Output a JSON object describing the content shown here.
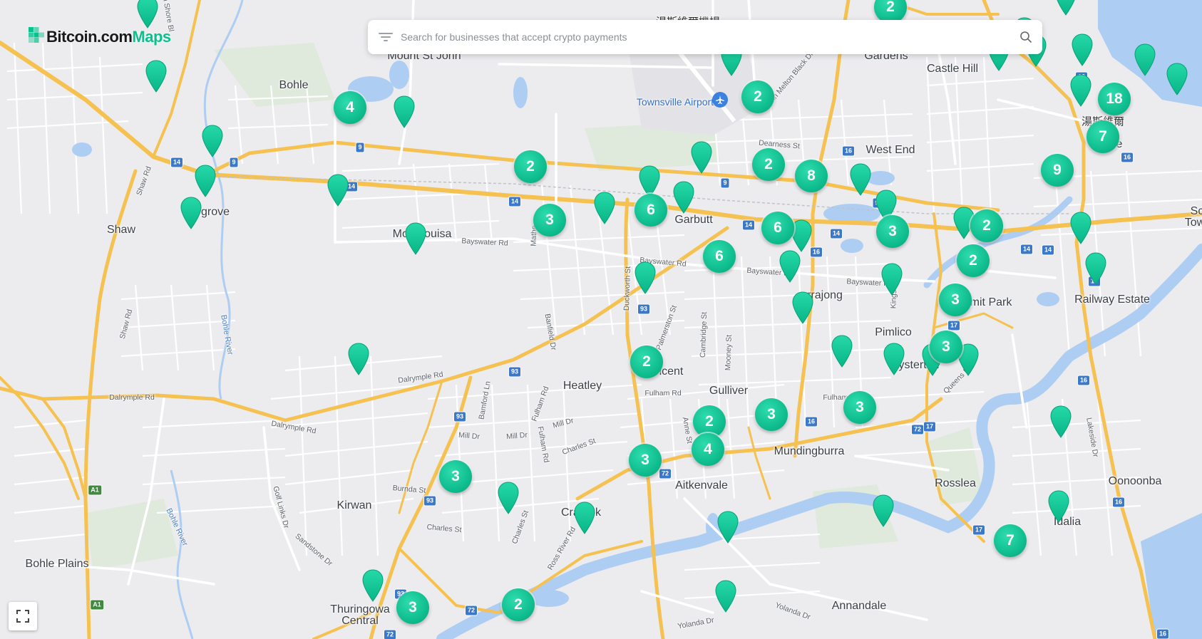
{
  "brand": {
    "name_primary": "Bitcoin.com",
    "name_secondary": "Maps",
    "accent_color": "#0ac18e"
  },
  "search": {
    "placeholder": "Search for businesses that accept crypto payments",
    "value": ""
  },
  "map": {
    "controls": {
      "fullscreen_icon": "fullscreen-icon"
    },
    "place_labels": [
      {
        "id": "mount-st-john",
        "text": "Mount St John",
        "kind": "suburb"
      },
      {
        "id": "bohle",
        "text": "Bohle",
        "kind": "suburb"
      },
      {
        "id": "gardens",
        "text": "Gardens",
        "kind": "suburb"
      },
      {
        "id": "castle-hill",
        "text": "Castle Hill",
        "kind": "suburb"
      },
      {
        "id": "townsville-airport",
        "text": "Townsville Airport",
        "kind": "airport"
      },
      {
        "id": "west-end",
        "text": "West End",
        "kind": "suburb"
      },
      {
        "id": "shaw",
        "text": "Shaw",
        "kind": "suburb"
      },
      {
        "id": "cosgrove",
        "text": "grove",
        "kind": "suburb"
      },
      {
        "id": "mount-louisa",
        "text": "Mou  Louisa",
        "kind": "suburb"
      },
      {
        "id": "garbutt",
        "text": "Garbutt",
        "kind": "suburb"
      },
      {
        "id": "currajong",
        "text": "rrajong",
        "kind": "suburb"
      },
      {
        "id": "pimlico",
        "text": "Pimlico",
        "kind": "suburb"
      },
      {
        "id": "hermit-park",
        "text": "mit Park",
        "kind": "suburb"
      },
      {
        "id": "railway-estate",
        "text": "Railway Estate",
        "kind": "suburb"
      },
      {
        "id": "townsville",
        "text": "To   ville",
        "kind": "suburb"
      },
      {
        "id": "townsville-cjk",
        "text": "湯斯維爾",
        "kind": "cjk"
      },
      {
        "id": "south-townsville-1",
        "text": "Sc",
        "kind": "suburb"
      },
      {
        "id": "south-townsville-2",
        "text": "Tow",
        "kind": "suburb"
      },
      {
        "id": "vincent",
        "text": "incent",
        "kind": "suburb"
      },
      {
        "id": "heatley",
        "text": "Heatley",
        "kind": "suburb"
      },
      {
        "id": "gulliver",
        "text": "Gulliver",
        "kind": "suburb"
      },
      {
        "id": "hyde-park",
        "text": "ysterton",
        "kind": "suburb"
      },
      {
        "id": "mundingburra",
        "text": "Mundingburra",
        "kind": "suburb"
      },
      {
        "id": "aitkenvale",
        "text": "Aitkenvale",
        "kind": "suburb"
      },
      {
        "id": "rosslea",
        "text": "Rosslea",
        "kind": "suburb"
      },
      {
        "id": "oonoonba",
        "text": "Oonoonba",
        "kind": "suburb"
      },
      {
        "id": "kirwan",
        "text": "Kirwan",
        "kind": "suburb"
      },
      {
        "id": "cranbrook",
        "text": "Cra   ook",
        "kind": "suburb"
      },
      {
        "id": "idalia",
        "text": "Idalia",
        "kind": "suburb"
      },
      {
        "id": "bohle-plains",
        "text": "Bohle Plains",
        "kind": "suburb"
      },
      {
        "id": "thuringowa-central-1",
        "text": "Thuringowa",
        "kind": "suburb"
      },
      {
        "id": "thuringowa-central-2",
        "text": "Central",
        "kind": "suburb"
      },
      {
        "id": "annandale",
        "text": "Annandale",
        "kind": "suburb"
      },
      {
        "id": "airport-cjk",
        "text": "湯斯維爾機場",
        "kind": "cjk"
      },
      {
        "id": "bayswater-rd-1",
        "text": "Bayswater Rd",
        "kind": "street"
      },
      {
        "id": "bayswater-rd-2",
        "text": "Bayswater Rd",
        "kind": "street"
      },
      {
        "id": "bayswater-rd-3",
        "text": "Bayswater Rd",
        "kind": "street"
      },
      {
        "id": "bayswater-rd-4",
        "text": "Bayswater Rd",
        "kind": "street"
      },
      {
        "id": "dalrymple-rd-1",
        "text": "Dalrymple Rd",
        "kind": "street"
      },
      {
        "id": "dalrymple-rd-2",
        "text": "Dalrymple Rd",
        "kind": "street"
      },
      {
        "id": "dalrymple-rd-3",
        "text": "Dalrymple Rd",
        "kind": "street"
      },
      {
        "id": "shaw-rd-1",
        "text": "Shaw Rd",
        "kind": "street"
      },
      {
        "id": "shaw-rd-2",
        "text": "Shaw Rd",
        "kind": "street"
      },
      {
        "id": "bohle-river-1",
        "text": "Bohle River",
        "kind": "water"
      },
      {
        "id": "bohle-river-2",
        "text": "Bohle River",
        "kind": "water"
      },
      {
        "id": "dearness-st",
        "text": "Dearness St",
        "kind": "street"
      },
      {
        "id": "duckworth-st",
        "text": "Duckworth St",
        "kind": "street"
      },
      {
        "id": "palmerston-st",
        "text": "Palmerston St",
        "kind": "street"
      },
      {
        "id": "cambridge-st",
        "text": "Cambridge St",
        "kind": "street"
      },
      {
        "id": "mooney-st",
        "text": "Mooney St",
        "kind": "street"
      },
      {
        "id": "kings-rd",
        "text": "Kings Rd",
        "kind": "street"
      },
      {
        "id": "fulham-rd-1",
        "text": "Fulham Rd",
        "kind": "street"
      },
      {
        "id": "fulham-rd-2",
        "text": "Fulham Rd",
        "kind": "street"
      },
      {
        "id": "fulham-rd-3",
        "text": "Fulham Rd",
        "kind": "street"
      },
      {
        "id": "mill-dr-1",
        "text": "Mill Dr",
        "kind": "street"
      },
      {
        "id": "mill-dr-2",
        "text": "Mill Dr",
        "kind": "street"
      },
      {
        "id": "mill-dr-3",
        "text": "Mill Dr",
        "kind": "street"
      },
      {
        "id": "charles-st-1",
        "text": "Charles St",
        "kind": "street"
      },
      {
        "id": "charles-st-2",
        "text": "Charles St",
        "kind": "street"
      },
      {
        "id": "charles-st-3",
        "text": "Charles St",
        "kind": "street"
      },
      {
        "id": "bamford-ln",
        "text": "Bamford Ln",
        "kind": "street"
      },
      {
        "id": "burnda-st",
        "text": "Burnda St",
        "kind": "street"
      },
      {
        "id": "golf-links-dr",
        "text": "Golf Links Dr",
        "kind": "street"
      },
      {
        "id": "sandstone-dr",
        "text": "Sandstone Dr",
        "kind": "street"
      },
      {
        "id": "ross-river-rd",
        "text": "Ross River Rd",
        "kind": "street"
      },
      {
        "id": "queens-rd",
        "text": "Queens Rd",
        "kind": "street"
      },
      {
        "id": "lakeside-dr",
        "text": "Lakeside Dr",
        "kind": "street"
      },
      {
        "id": "yolanda-dr-1",
        "text": "Yolanda Dr",
        "kind": "street"
      },
      {
        "id": "yolanda-dr-2",
        "text": "Yolanda Dr",
        "kind": "street"
      },
      {
        "id": "anne-st",
        "text": "Anne St",
        "kind": "street"
      },
      {
        "id": "north-shore-blvd",
        "text": "h Shore Bl",
        "kind": "street"
      },
      {
        "id": "john-melton-black-dr",
        "text": "John Melton Black Dr",
        "kind": "street"
      },
      {
        "id": "banfield-dr",
        "text": "Banfield Dr",
        "kind": "street"
      },
      {
        "id": "fulham-st-2",
        "text": "Fulham Rd",
        "kind": "street"
      },
      {
        "id": "mather-st",
        "text": "Mathe",
        "kind": "street"
      },
      {
        "id": "bohle-river-3",
        "text": "Bohle River",
        "kind": "water"
      }
    ],
    "route_shields": [
      {
        "id": "s1",
        "text": "9"
      },
      {
        "id": "s2",
        "text": "14"
      },
      {
        "id": "s3",
        "text": "9"
      },
      {
        "id": "s4",
        "text": "14"
      },
      {
        "id": "s5",
        "text": "14"
      },
      {
        "id": "s6",
        "text": "9"
      },
      {
        "id": "s7",
        "text": "14"
      },
      {
        "id": "s8",
        "text": "9"
      },
      {
        "id": "s9",
        "text": "16"
      },
      {
        "id": "s10",
        "text": "14"
      },
      {
        "id": "s11",
        "text": "16"
      },
      {
        "id": "s12",
        "text": "14"
      },
      {
        "id": "s13",
        "text": "16"
      },
      {
        "id": "s14",
        "text": "16"
      },
      {
        "id": "s15",
        "text": "16"
      },
      {
        "id": "s16",
        "text": "93"
      },
      {
        "id": "s17",
        "text": "93"
      },
      {
        "id": "s18",
        "text": "17"
      },
      {
        "id": "s19",
        "text": "93"
      },
      {
        "id": "s20",
        "text": "16"
      },
      {
        "id": "s21",
        "text": "72"
      },
      {
        "id": "s22",
        "text": "17"
      },
      {
        "id": "s23",
        "text": "93"
      },
      {
        "id": "s24",
        "text": "72"
      },
      {
        "id": "s25",
        "text": "17"
      },
      {
        "id": "s26",
        "text": "16"
      },
      {
        "id": "s27",
        "text": "93"
      },
      {
        "id": "s28",
        "text": "72"
      },
      {
        "id": "s29",
        "text": "72"
      },
      {
        "id": "s30",
        "text": "A1"
      },
      {
        "id": "s31",
        "text": "A1"
      },
      {
        "id": "s32",
        "text": "16"
      },
      {
        "id": "s33",
        "text": "16"
      },
      {
        "id": "s34",
        "text": "14"
      }
    ],
    "clusters": [
      {
        "id": "c01",
        "count": "2"
      },
      {
        "id": "c02",
        "count": "4"
      },
      {
        "id": "c03",
        "count": "2"
      },
      {
        "id": "c04",
        "count": "18"
      },
      {
        "id": "c05",
        "count": "7"
      },
      {
        "id": "c06",
        "count": "2"
      },
      {
        "id": "c07",
        "count": "2"
      },
      {
        "id": "c08",
        "count": "8"
      },
      {
        "id": "c09",
        "count": "9"
      },
      {
        "id": "c10",
        "count": "3"
      },
      {
        "id": "c11",
        "count": "6"
      },
      {
        "id": "c12",
        "count": "6"
      },
      {
        "id": "c13",
        "count": "3"
      },
      {
        "id": "c14",
        "count": "2"
      },
      {
        "id": "c15",
        "count": "6"
      },
      {
        "id": "c16",
        "count": "2"
      },
      {
        "id": "c17",
        "count": "3"
      },
      {
        "id": "c18",
        "count": "3"
      },
      {
        "id": "c19",
        "count": "2"
      },
      {
        "id": "c20",
        "count": "3"
      },
      {
        "id": "c21",
        "count": "3"
      },
      {
        "id": "c22",
        "count": "2"
      },
      {
        "id": "c23",
        "count": "4"
      },
      {
        "id": "c24",
        "count": "3"
      },
      {
        "id": "c25",
        "count": "3"
      },
      {
        "id": "c26",
        "count": "7"
      },
      {
        "id": "c27",
        "count": "3"
      },
      {
        "id": "c28",
        "count": "2"
      }
    ],
    "single_pin_count": 44,
    "colors": {
      "land": "#ececef",
      "water": "#aecdf2",
      "major_road": "#f5c150",
      "minor_road": "#ffffff",
      "marker": "#0ac18e",
      "park": "#dce9d8"
    }
  }
}
